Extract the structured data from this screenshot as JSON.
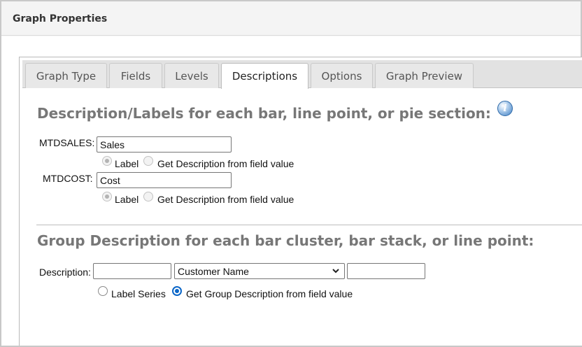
{
  "window": {
    "title": "Graph Properties"
  },
  "tabs": [
    {
      "label": "Graph Type",
      "active": false
    },
    {
      "label": "Fields",
      "active": false
    },
    {
      "label": "Levels",
      "active": false
    },
    {
      "label": "Descriptions",
      "active": true
    },
    {
      "label": "Options",
      "active": false
    },
    {
      "label": "Graph Preview",
      "active": false
    }
  ],
  "descriptions": {
    "heading": "Description/Labels for each bar, line point, or pie section:",
    "info_icon": "info-icon",
    "fields": [
      {
        "label": "MTDSALES:",
        "value": "Sales",
        "option_label": "Label",
        "option_field": "Get Description from field value",
        "selected": "label"
      },
      {
        "label": "MTDCOST:",
        "value": "Cost",
        "option_label": "Label",
        "option_field": "Get Description from field value",
        "selected": "label"
      }
    ]
  },
  "group": {
    "heading": "Group Description for each bar cluster, bar stack, or line point:",
    "description_label": "Description:",
    "prefix_value": "",
    "field_select": "Customer Name",
    "suffix_value": "",
    "option_series": "Label Series",
    "option_field": "Get Group Description from field value",
    "selected": "field"
  },
  "colors": {
    "accent": "#0a66c8",
    "heading": "#777777",
    "tab_bg": "#e8e8e8"
  }
}
